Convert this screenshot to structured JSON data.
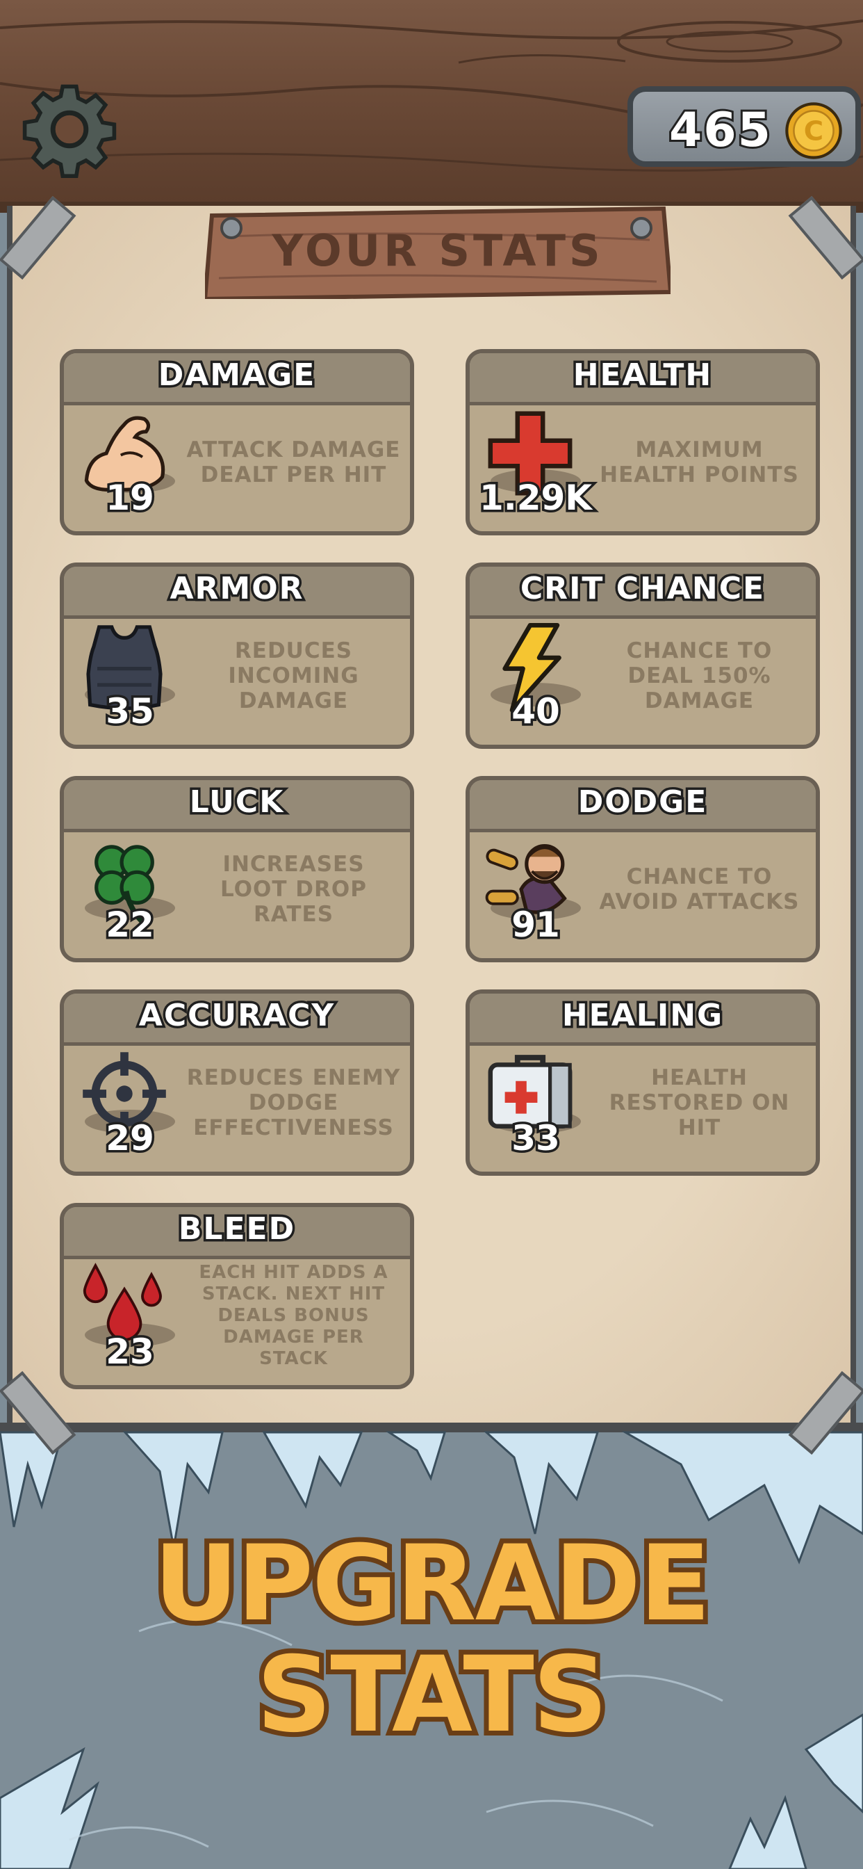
{
  "currency": {
    "amount": "465",
    "symbol": "C"
  },
  "header": {
    "title": "YOUR STATS"
  },
  "stats": [
    {
      "name": "DAMAGE",
      "value": "19",
      "description": "ATTACK DAMAGE DEALT PER HIT",
      "icon": "flexed-arm-icon"
    },
    {
      "name": "HEALTH",
      "value": "1.29K",
      "description": "MAXIMUM HEALTH POINTS",
      "icon": "red-cross-icon"
    },
    {
      "name": "ARMOR",
      "value": "35",
      "description": "REDUCES INCOMING DAMAGE",
      "icon": "body-armor-icon"
    },
    {
      "name": "CRIT CHANCE",
      "value": "40",
      "description": "CHANCE TO DEAL 150% DAMAGE",
      "icon": "lightning-icon"
    },
    {
      "name": "LUCK",
      "value": "22",
      "description": "INCREASES LOOT DROP RATES",
      "icon": "clover-icon"
    },
    {
      "name": "DODGE",
      "value": "91",
      "description": "CHANCE TO AVOID ATTACKS",
      "icon": "dodging-man-icon"
    },
    {
      "name": "ACCURACY",
      "value": "29",
      "description": "REDUCES ENEMY DODGE EFFECTIVENESS",
      "icon": "crosshair-icon"
    },
    {
      "name": "HEALING",
      "value": "33",
      "description": "HEALTH RESTORED ON HIT",
      "icon": "first-aid-kit-icon"
    },
    {
      "name": "BLEED",
      "value": "23",
      "description": "EACH HIT ADDS A STACK. NEXT HIT DEALS BONUS DAMAGE PER STACK",
      "icon": "blood-drops-icon"
    }
  ],
  "promo": {
    "line1": "UPGRADE",
    "line2": "STATS"
  },
  "colors": {
    "wood": "#6b4a37",
    "parchment": "#e7d7be",
    "card": "#b8a88c",
    "card_header": "#958a77",
    "gold": "#f7b84a",
    "ice": "#7e8d97"
  }
}
